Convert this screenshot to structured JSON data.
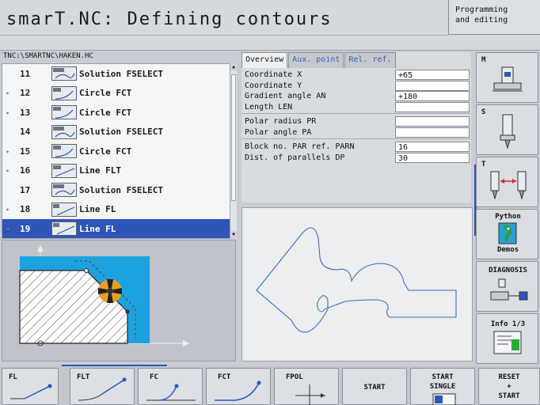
{
  "header": {
    "title": "smarT.NC: Defining contours",
    "mode_line1": "Programming",
    "mode_line2": "and editing"
  },
  "tree": {
    "path": "TNC:\\SMARTNC\\HAKEN.HC",
    "rows": [
      {
        "expander": "",
        "number": "11",
        "icon": "fselect-icon",
        "label": "Solution FSELECT",
        "selected": false
      },
      {
        "expander": "▸",
        "number": "12",
        "icon": "circle-fct-icon",
        "label": "Circle FCT",
        "selected": false
      },
      {
        "expander": "▸",
        "number": "13",
        "icon": "circle-fct-icon",
        "label": "Circle FCT",
        "selected": false
      },
      {
        "expander": "",
        "number": "14",
        "icon": "fselect-icon",
        "label": "Solution FSELECT",
        "selected": false
      },
      {
        "expander": "▸",
        "number": "15",
        "icon": "circle-fct-icon",
        "label": "Circle FCT",
        "selected": false
      },
      {
        "expander": "▸",
        "number": "16",
        "icon": "line-flt-icon",
        "label": "Line FLT",
        "selected": false
      },
      {
        "expander": "",
        "number": "17",
        "icon": "fselect-icon",
        "label": "Solution FSELECT",
        "selected": false
      },
      {
        "expander": "▸",
        "number": "18",
        "icon": "line-fl-icon",
        "label": "Line FL",
        "selected": false
      },
      {
        "expander": "·",
        "number": "19",
        "icon": "line-fl-icon",
        "label": "Line FL",
        "selected": true
      }
    ]
  },
  "form": {
    "tabs": [
      "Overview",
      "Aux. point",
      "Rel. ref."
    ],
    "active_tab": "Overview",
    "fields": [
      {
        "label": "Coordinate X",
        "value": "+65"
      },
      {
        "label": "Coordinate Y",
        "value": ""
      },
      {
        "label": "Gradient angle AN",
        "value": "+180"
      },
      {
        "label": "Length LEN",
        "value": ""
      },
      {
        "label": "Polar radius PR",
        "value": ""
      },
      {
        "label": "Polar angle PA",
        "value": ""
      },
      {
        "label": "Block no. PAR ref. PARN",
        "value": "16"
      },
      {
        "label": "Dist. of parallels DP",
        "value": "30"
      }
    ]
  },
  "right_softkeys": {
    "m_label": "M",
    "s_label": "S",
    "t_label": "T",
    "python_label": "Python",
    "demos_label": "Demos",
    "diagnosis_label": "DIAGNOSIS",
    "info_label": "Info 1/3"
  },
  "bottom_softkeys": {
    "fl": "FL",
    "flt": "FLT",
    "fc": "FC",
    "fct": "FCT",
    "fpol": "FPOL",
    "start": "START",
    "start_single_1": "START",
    "start_single_2": "SINGLE",
    "reset_1": "RESET",
    "reset_2": "+",
    "reset_3": "START"
  },
  "colors": {
    "selection": "#2e55b8",
    "contour_line": "#3b6fb6",
    "help_material": "#1da2e0"
  }
}
